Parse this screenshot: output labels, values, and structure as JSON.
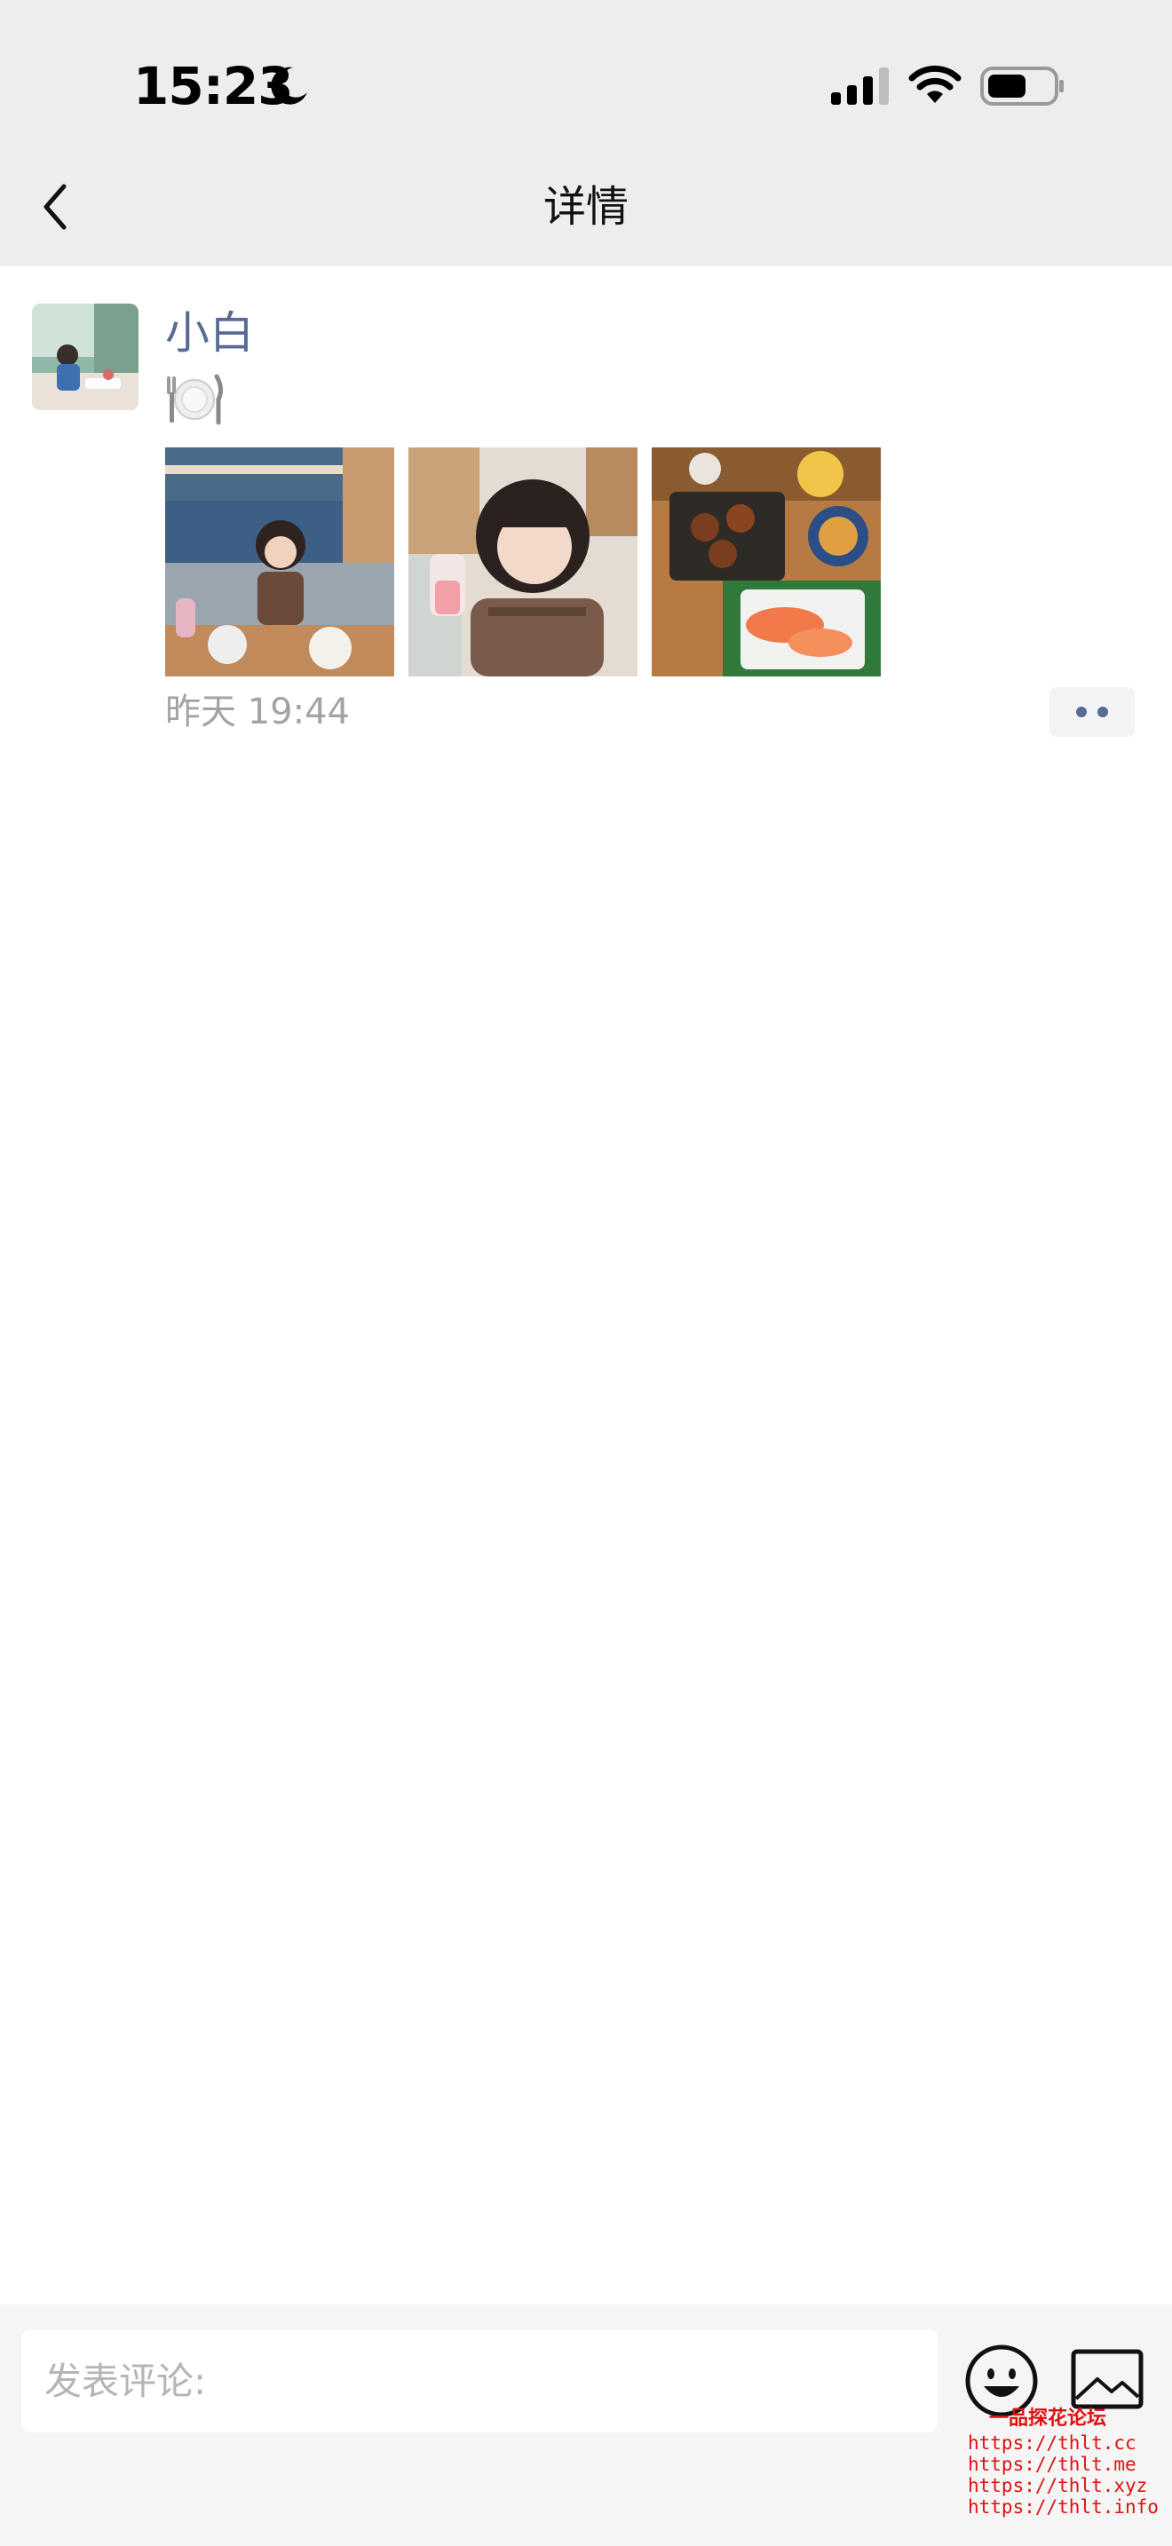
{
  "status_bar": {
    "time": "15:23",
    "icons": [
      "moon-icon",
      "signal-icon",
      "wifi-icon",
      "battery-icon"
    ]
  },
  "nav": {
    "title": "详情",
    "back_icon": "chevron-left-icon"
  },
  "post": {
    "user_name": "小白",
    "content_emoji": "plate-cutlery-icon",
    "photos": [
      {
        "name": "photo-girl-in-restaurant"
      },
      {
        "name": "photo-girl-selfie-with-drink"
      },
      {
        "name": "photo-food-platter"
      }
    ],
    "time": "昨天 19:44",
    "more_icon": "two-dots-icon"
  },
  "comment_bar": {
    "placeholder": "发表评论:",
    "emoji_icon": "smiley-icon",
    "image_icon": "image-icon"
  },
  "watermark": {
    "title": "一品探花论坛",
    "lines": [
      "https://thlt.cc",
      "https://thlt.me",
      "https://thlt.xyz",
      "https://thlt.info"
    ]
  },
  "colors": {
    "link_blue": "#576b95",
    "bar_gray": "#ededed",
    "muted_text": "#a3a3a3",
    "watermark_red": "#e01010"
  }
}
